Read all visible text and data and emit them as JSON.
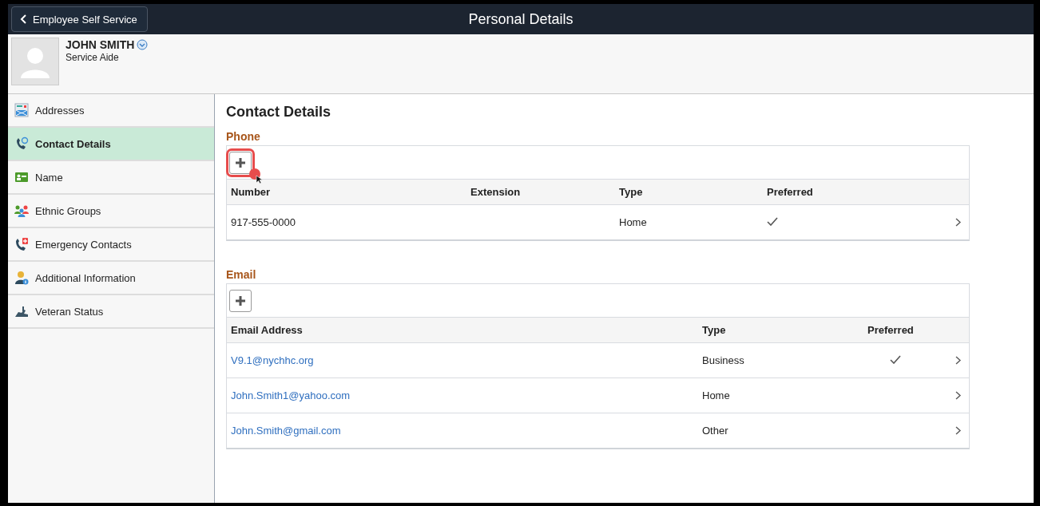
{
  "header": {
    "back_label": "Employee Self Service",
    "title": "Personal Details"
  },
  "profile": {
    "name": "JOHN SMITH",
    "job": "Service Aide"
  },
  "sidebar": {
    "items": [
      {
        "label": "Addresses",
        "kind": "addresses",
        "selected": false
      },
      {
        "label": "Contact Details",
        "kind": "contact",
        "selected": true
      },
      {
        "label": "Name",
        "kind": "name",
        "selected": false
      },
      {
        "label": "Ethnic Groups",
        "kind": "ethnic",
        "selected": false
      },
      {
        "label": "Emergency Contacts",
        "kind": "emergency",
        "selected": false
      },
      {
        "label": "Additional Information",
        "kind": "info",
        "selected": false
      },
      {
        "label": "Veteran Status",
        "kind": "veteran",
        "selected": false
      }
    ]
  },
  "content": {
    "title": "Contact Details",
    "phone": {
      "heading": "Phone",
      "add_highlighted": true,
      "columns": [
        "Number",
        "Extension",
        "Type",
        "Preferred"
      ],
      "rows": [
        {
          "number": "917-555-0000",
          "type": "Home",
          "preferred": true
        }
      ]
    },
    "email": {
      "heading": "Email",
      "add_highlighted": false,
      "columns": [
        "Email Address",
        "Type",
        "Preferred"
      ],
      "rows": [
        {
          "address": "V9.1@nychhc.org",
          "type": "Business",
          "preferred": true
        },
        {
          "address": "John.Smith1@yahoo.com",
          "type": "Home",
          "preferred": false
        },
        {
          "address": "John.Smith@gmail.com",
          "type": "Other",
          "preferred": false
        }
      ]
    }
  }
}
